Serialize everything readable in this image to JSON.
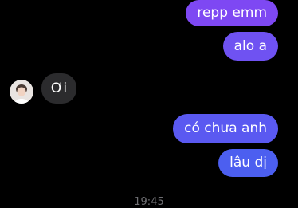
{
  "colors": {
    "background": "#000000",
    "outgoing_top": "#7b4cf2",
    "outgoing_bottom": "#4f5ff0",
    "incoming": "#2b2b2d",
    "timestamp": "#6f6f73"
  },
  "messages": [
    {
      "direction": "outgoing",
      "text": "repp emm"
    },
    {
      "direction": "outgoing",
      "text": "alo a"
    },
    {
      "direction": "incoming",
      "text": "Ơi"
    },
    {
      "direction": "outgoing",
      "text": "có chưa anh"
    },
    {
      "direction": "outgoing",
      "text": "lâu dị"
    }
  ],
  "timestamp": "19:45",
  "contact": {
    "avatar_icon": "contact-avatar-icon"
  }
}
